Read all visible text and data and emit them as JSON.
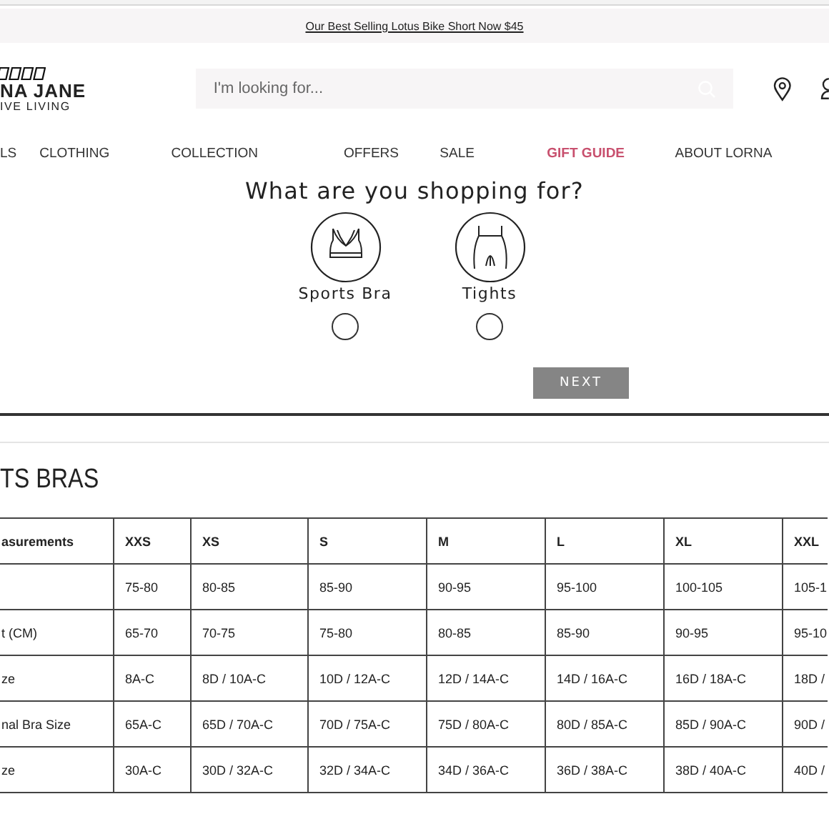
{
  "promo": {
    "link": "Our Best Selling Lotus Bike Short Now $45"
  },
  "logo": {
    "name": "NA JANE",
    "tagline": "IVE LIVING"
  },
  "search": {
    "placeholder": "I'm looking for..."
  },
  "nav": [
    {
      "label": "LS",
      "kind": "normal"
    },
    {
      "label": "CLOTHING",
      "kind": "normal"
    },
    {
      "label": "COLLECTION",
      "kind": "normal"
    },
    {
      "label": "OFFERS",
      "kind": "normal"
    },
    {
      "label": "SALE",
      "kind": "normal"
    },
    {
      "label": "GIFT GUIDE",
      "kind": "highlight"
    },
    {
      "label": "ABOUT LORNA",
      "kind": "normal"
    }
  ],
  "quiz": {
    "title": "What are you shopping for?",
    "options": [
      {
        "label": "Sports Bra",
        "kind": "bra",
        "selected": false
      },
      {
        "label": "Tights",
        "kind": "tights",
        "selected": false
      }
    ],
    "button": "NEXT"
  },
  "section": {
    "title": "TS BRAS"
  },
  "table": {
    "columns": [
      "asurements",
      "XXS",
      "XS",
      "S",
      "M",
      "L",
      "XL",
      "XXL"
    ],
    "rows": [
      [
        "",
        "75-80",
        "80-85",
        "85-90",
        "90-95",
        "95-100",
        "100-105",
        "105-1"
      ],
      [
        "t (CM)",
        "65-70",
        "70-75",
        "75-80",
        "80-85",
        "85-90",
        "90-95",
        "95-10"
      ],
      [
        "ze",
        "8A-C",
        "8D / 10A-C",
        "10D / 12A-C",
        "12D / 14A-C",
        "14D / 16A-C",
        "16D / 18A-C",
        "18D /"
      ],
      [
        "nal Bra Size",
        "65A-C",
        "65D / 70A-C",
        "70D / 75A-C",
        "75D / 80A-C",
        "80D / 85A-C",
        "85D / 90A-C",
        "90D /"
      ],
      [
        "ze",
        "30A-C",
        "30D / 32A-C",
        "32D / 34A-C",
        "34D / 36A-C",
        "36D / 38A-C",
        "38D / 40A-C",
        "40D /"
      ]
    ]
  }
}
